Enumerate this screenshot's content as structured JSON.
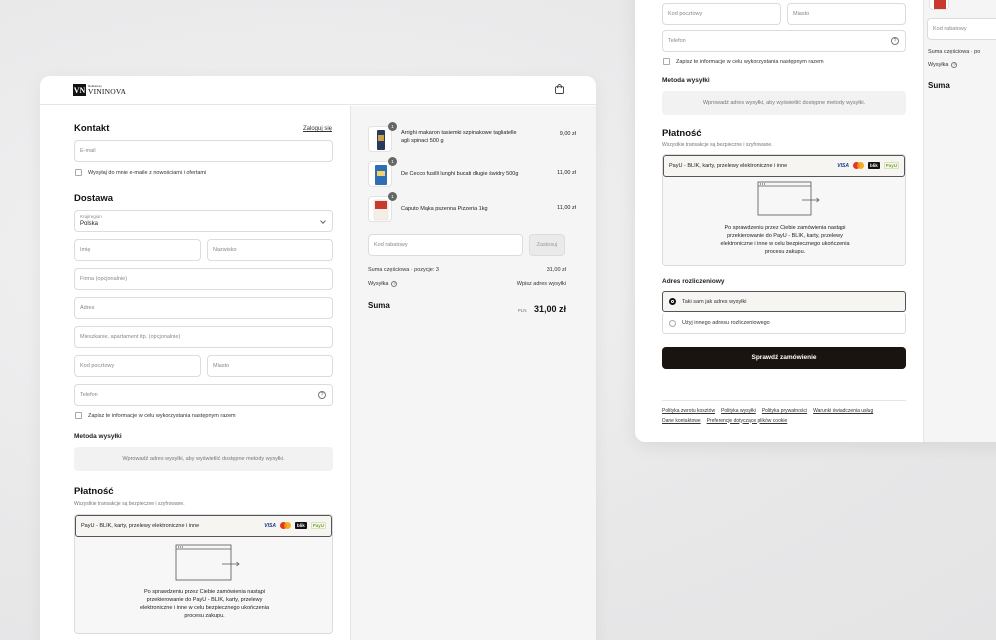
{
  "brand": {
    "logo_mark": "VN",
    "logo_small": "Delikatesy",
    "logo_big": "VININOVA"
  },
  "contact": {
    "title": "Kontakt",
    "login_link": "Zaloguj się",
    "email_placeholder": "E-mail",
    "newsletter_label": "Wysyłaj do mnie e-maile z nowościami i ofertami"
  },
  "delivery": {
    "title": "Dostawa",
    "country_label": "Kraj/region",
    "country_value": "Polska",
    "first_name": "Imię",
    "last_name": "Nazwisko",
    "company": "Firma (opcjonalnie)",
    "address": "Adres",
    "apartment": "Mieszkanie, apartament itp. (opcjonalnie)",
    "postal": "Kod pocztowy",
    "city": "Miasto",
    "phone": "Telefon",
    "save_info": "Zapisz te informacje w celu wykorzystania następnym razem"
  },
  "shipping_method": {
    "title": "Metoda wysyłki",
    "info": "Wprowadź adres wysyłki, aby wyświetlić dostępne metody wysyłki."
  },
  "payment": {
    "title": "Płatność",
    "note": "Wszystkie transakcje są bezpieczne i szyfrowane.",
    "option_label": "PayU - BLIK, karty, przelewy elektroniczne i inne",
    "cards": {
      "visa": "VISA",
      "blik": "blik",
      "payu": "PayU"
    },
    "redirect_line1": "Po sprawdzeniu przez Ciebie zamówienia nastąpi",
    "redirect_line2": "przekierowanie do PayU - BLIK, karty, przelewy",
    "redirect_line3": "elektroniczne i inne w celu bezpiecznego ukończenia",
    "redirect_line4": "procesu zakupu."
  },
  "summary": {
    "items": [
      {
        "name_line1": "Arrighi makaron tasiemki szpinakowe tagliatelle",
        "name_line2": "agli spinaci 500 g",
        "price": "9,00 zł",
        "qty": "1"
      },
      {
        "name_line1": "De Cecco fusilli lunghi bucati długie świdry 500g",
        "name_line2": "",
        "price": "11,00 zł",
        "qty": "1"
      },
      {
        "name_line1": "Caputo Mąka pszenna Pizzeria 1kg",
        "name_line2": "",
        "price": "11,00 zł",
        "qty": "1"
      }
    ],
    "discount_placeholder": "Kod rabatowy",
    "apply_label": "Zastosuj",
    "subtotal_label": "Suma częściowa · pozycje: 3",
    "subtotal_value": "31,00 zł",
    "shipping_label": "Wysyłka",
    "shipping_value": "Wpisz adres wysyłki",
    "total_label": "Suma",
    "currency": "PLN",
    "total_value": "31,00 zł"
  },
  "right": {
    "billing_title": "Adres rozliczeniowy",
    "billing_same": "Taki sam jak adres wysyłki",
    "billing_other": "Użyj innego adresu rozliczeniowego",
    "review_button": "Sprawdź zamówienie",
    "footer": [
      "Polityka zwrotu kosztów",
      "Polityka wysyłki",
      "Polityka prywatności",
      "Warunki świadczenia usług",
      "Dane kontaktowe",
      "Preferencje dotyczące plików cookie"
    ],
    "summary_subtotal": "Suma częściowa · po",
    "summary_shipping": "Wysyłka",
    "summary_total": "Suma"
  },
  "colors": {
    "primary_button": "#1a1410",
    "accent_border": "#555555"
  }
}
